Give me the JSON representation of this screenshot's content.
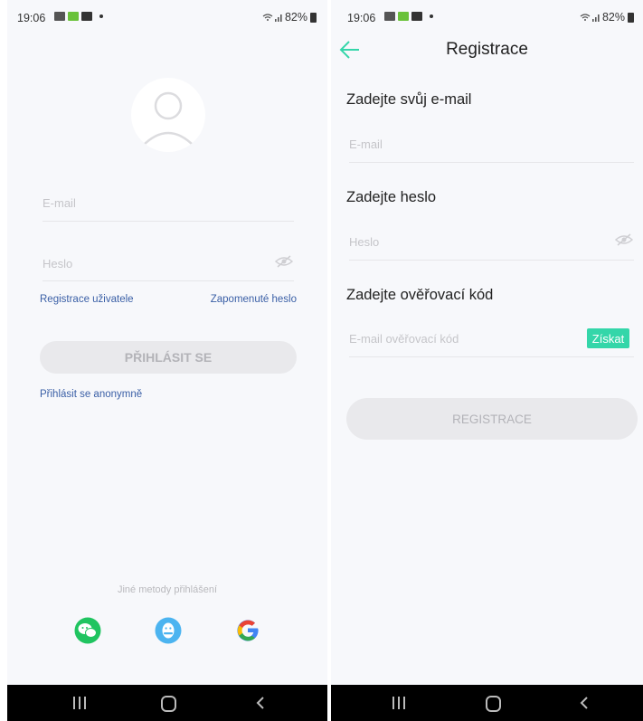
{
  "status_bar": {
    "time": "19:06",
    "battery": "82%"
  },
  "login": {
    "email_placeholder": "E-mail",
    "password_placeholder": "Heslo",
    "register_link": "Registrace uživatele",
    "forgot_link": "Zapomenuté heslo",
    "login_button": "PŘIHLÁSIT SE",
    "anonymous_link": "Přihlásit se anonymně",
    "other_methods": "Jiné metody přihlášení",
    "social_icons": [
      "wechat-icon",
      "qq-icon",
      "google-icon"
    ]
  },
  "register": {
    "title": "Registrace",
    "email_label": "Zadejte svůj e-mail",
    "email_placeholder": "E-mail",
    "password_label": "Zadejte heslo",
    "password_placeholder": "Heslo",
    "code_label": "Zadejte ověřovací kód",
    "code_placeholder": "E-mail ověřovací kód",
    "get_code_button": "Získat",
    "register_button": "REGISTRACE"
  },
  "colors": {
    "accent": "#34d6a9",
    "link": "#3a5fa6",
    "wechat": "#20c460",
    "qq": "#4cb4f0"
  }
}
